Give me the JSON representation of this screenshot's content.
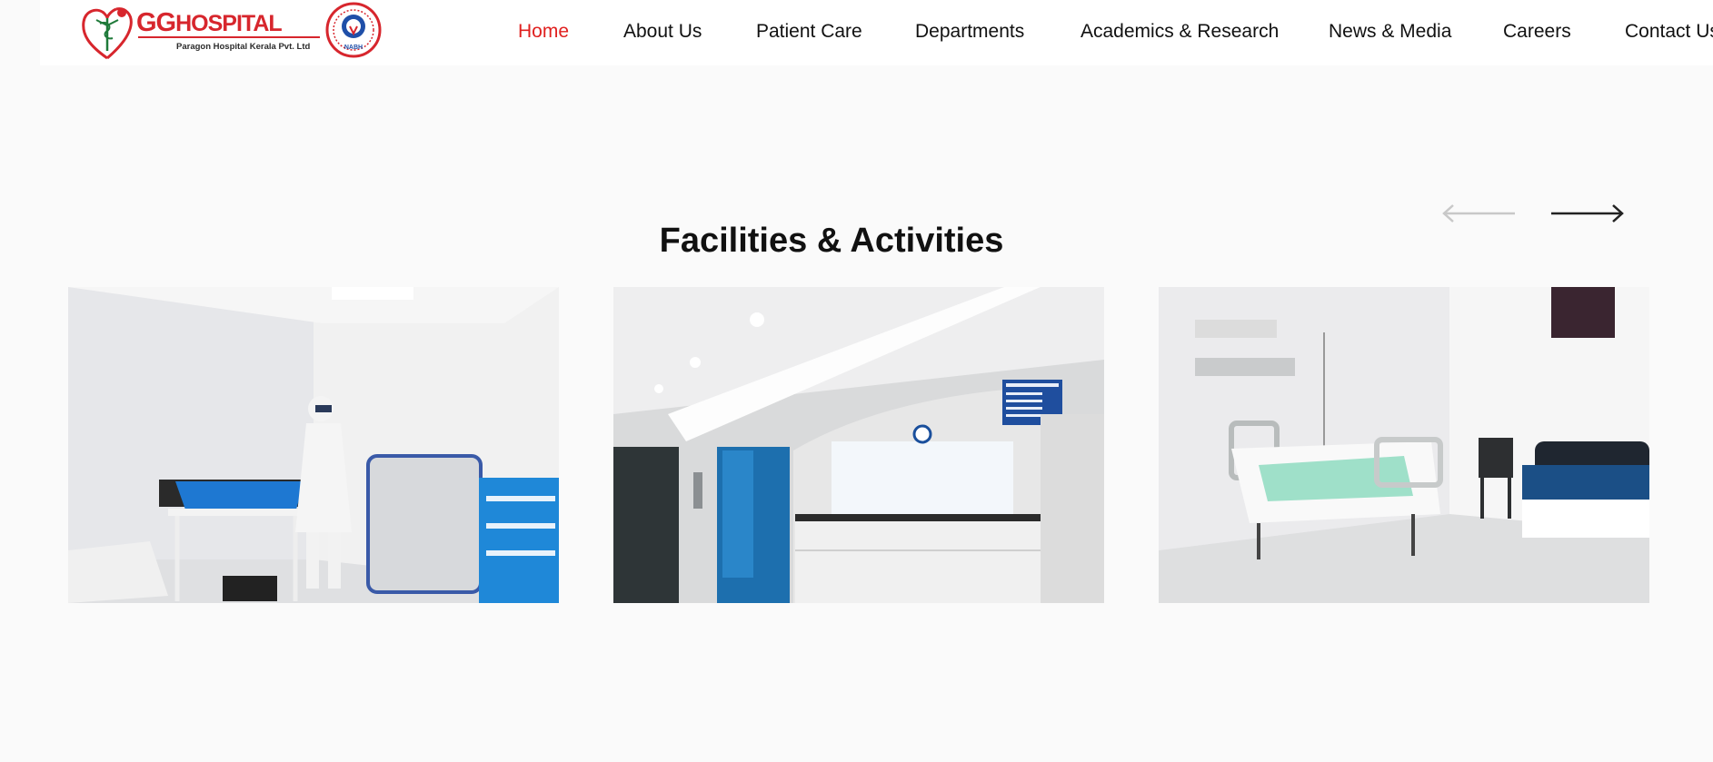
{
  "brand": {
    "name_gg": "GG",
    "name_hospital": "HOSPITAL",
    "subtitle": "Paragon Hospital Kerala Pvt. Ltd",
    "badge_text": "NABH",
    "logo_icon": "caduceus-heart-icon",
    "badge_icon": "accreditation-seal-icon",
    "brand_color": "#d7262d",
    "badge_color": "#1f4fa8"
  },
  "nav": {
    "items": [
      {
        "label": "Home",
        "active": true
      },
      {
        "label": "About Us",
        "active": false
      },
      {
        "label": "Patient Care",
        "active": false
      },
      {
        "label": "Departments",
        "active": false
      },
      {
        "label": "Academics & Research",
        "active": false
      },
      {
        "label": "News & Media",
        "active": false
      },
      {
        "label": "Careers",
        "active": false
      },
      {
        "label": "Contact Us",
        "active": false
      }
    ],
    "active_color": "#e0201f"
  },
  "facilities": {
    "title": "Facilities & Activities",
    "prev_icon": "arrow-left-icon",
    "next_icon": "arrow-right-icon",
    "prev_enabled": false,
    "next_enabled": true,
    "cards": [
      {
        "image": "examination-room-photo"
      },
      {
        "image": "reception-desk-photo"
      },
      {
        "image": "patient-ward-photo"
      }
    ]
  }
}
